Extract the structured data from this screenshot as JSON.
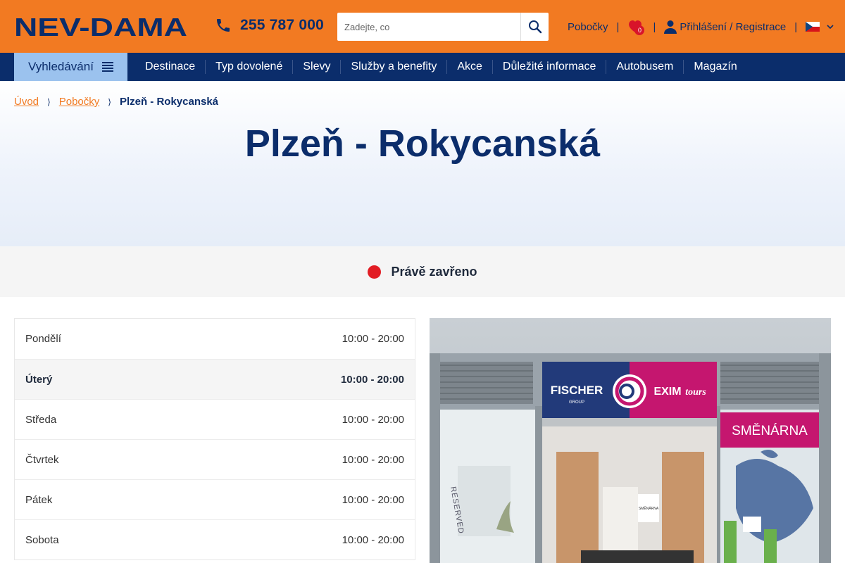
{
  "header": {
    "logo_text": "NEV-DAMA",
    "phone": "255 787 000",
    "search_placeholder": "Zadejte, co",
    "branches_link": "Pobočky",
    "favorites_count": "0",
    "login_link": "Přihlášení / Registrace",
    "separator": "|",
    "language": "cs"
  },
  "nav": {
    "search_label": "Vyhledávání",
    "items": [
      "Destinace",
      "Typ dovolené",
      "Slevy",
      "Služby a benefity",
      "Akce",
      "Důležité informace",
      "Autobusem",
      "Magazín"
    ]
  },
  "breadcrumb": {
    "home": "Úvod",
    "branches": "Pobočky",
    "current": "Plzeň - Rokycanská",
    "separator": "⟩"
  },
  "page": {
    "title": "Plzeň - Rokycanská"
  },
  "status": {
    "text": "Právě zavřeno",
    "color": "#e21d24"
  },
  "hours": [
    {
      "day": "Pondělí",
      "time": "10:00 - 20:00"
    },
    {
      "day": "Úterý",
      "time": "10:00 - 20:00"
    },
    {
      "day": "Středa",
      "time": "10:00 - 20:00"
    },
    {
      "day": "Čtvrtek",
      "time": "10:00 - 20:00"
    },
    {
      "day": "Pátek",
      "time": "10:00 - 20:00"
    },
    {
      "day": "Sobota",
      "time": "10:00 - 20:00"
    }
  ],
  "photo": {
    "sign_left": "FISCHER",
    "sign_left_sub": "GROUP",
    "sign_right": "EXIM",
    "sign_right_sub": "tours",
    "exchange_sign": "SMĚNÁRNA",
    "window_text": "RESERVED",
    "inner_sign": "SMĚNÁRNA"
  },
  "colors": {
    "brand_orange": "#f27a22",
    "brand_navy": "#0b2d6b",
    "nav_search_bg": "#9bc2ee"
  }
}
